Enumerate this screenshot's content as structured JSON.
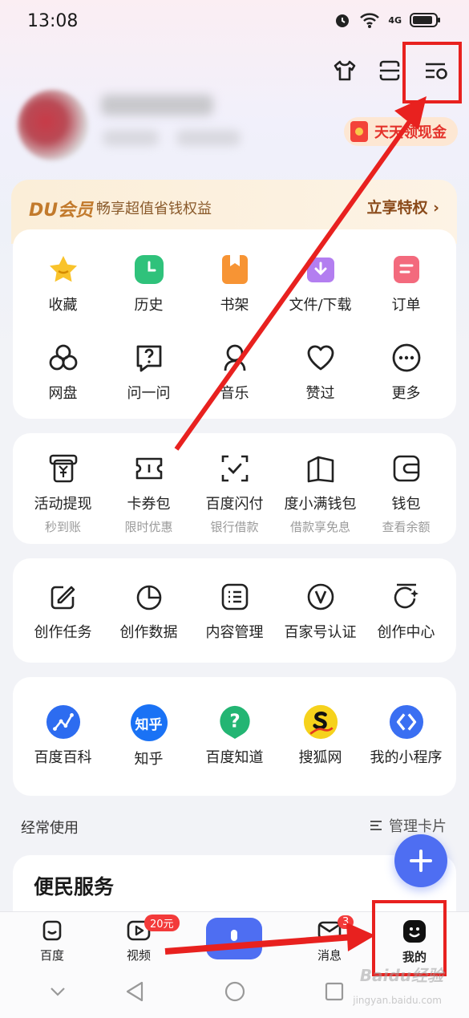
{
  "status_bar": {
    "time": "13:08",
    "network": "4G"
  },
  "profile": {
    "cash_label": "天天领现金",
    "cash_visible": "天 领现金"
  },
  "vip": {
    "logo": "DU会员",
    "desc": "畅享超值省钱权益",
    "link": "立享特权"
  },
  "quick_grid": [
    {
      "label": "收藏",
      "icon": "star-icon",
      "color": "#f9c32b"
    },
    {
      "label": "历史",
      "icon": "clock-icon",
      "color": "#2fc27b"
    },
    {
      "label": "书架",
      "icon": "bookshelf-icon",
      "color": "#f79434"
    },
    {
      "label": "文件/下载",
      "icon": "download-icon",
      "color": "#b37ef0"
    },
    {
      "label": "订单",
      "icon": "order-icon",
      "color": "#f36a7d"
    },
    {
      "label": "网盘",
      "icon": "cloud-disk-icon"
    },
    {
      "label": "问一问",
      "icon": "question-icon"
    },
    {
      "label": "音乐",
      "icon": "music-icon"
    },
    {
      "label": "赞过",
      "icon": "heart-icon"
    },
    {
      "label": "更多",
      "icon": "more-icon"
    }
  ],
  "finance": [
    {
      "label": "活动提现",
      "sub": "秒到账",
      "icon": "cash-withdraw-icon"
    },
    {
      "label": "卡券包",
      "sub": "限时优惠",
      "icon": "coupon-icon"
    },
    {
      "label": "百度闪付",
      "sub": "银行借款",
      "icon": "flash-pay-icon"
    },
    {
      "label": "度小满钱包",
      "sub": "借款享免息",
      "icon": "wallet-book-icon"
    },
    {
      "label": "钱包",
      "sub": "查看余额",
      "icon": "wallet-icon"
    }
  ],
  "creator": [
    {
      "label": "创作任务",
      "icon": "edit-task-icon"
    },
    {
      "label": "创作数据",
      "icon": "pie-chart-icon"
    },
    {
      "label": "内容管理",
      "icon": "list-icon"
    },
    {
      "label": "百家号认证",
      "icon": "verified-icon"
    },
    {
      "label": "创作中心",
      "icon": "creator-center-icon"
    }
  ],
  "apps": [
    {
      "label": "百度百科",
      "icon": "baike-icon",
      "color": "#2d6cf0"
    },
    {
      "label": "知乎",
      "icon": "zhihu-icon",
      "color": "#1a72f5",
      "text": "知乎"
    },
    {
      "label": "百度知道",
      "icon": "zhidao-icon",
      "color": "#23b573"
    },
    {
      "label": "搜狐网",
      "icon": "sohu-icon",
      "color": "#f6d21c"
    },
    {
      "label": "我的小程序",
      "icon": "mini-program-icon",
      "color": "#3a6ff2"
    }
  ],
  "section": {
    "title": "经常使用",
    "manage": "管理卡片",
    "service": "便民服务"
  },
  "bottom_nav": [
    {
      "label": "百度",
      "icon": "baidu-home-icon"
    },
    {
      "label": "视频",
      "icon": "video-icon",
      "badge": "20元"
    },
    {
      "label": "消息",
      "icon": "message-icon",
      "badge": "3"
    },
    {
      "label": "我的",
      "icon": "me-icon"
    }
  ],
  "watermark": {
    "brand": "Baidu经验",
    "url": "jingyan.baidu.com"
  },
  "colors": {
    "accent": "#4e6ef2",
    "annotation": "#e8211f"
  }
}
